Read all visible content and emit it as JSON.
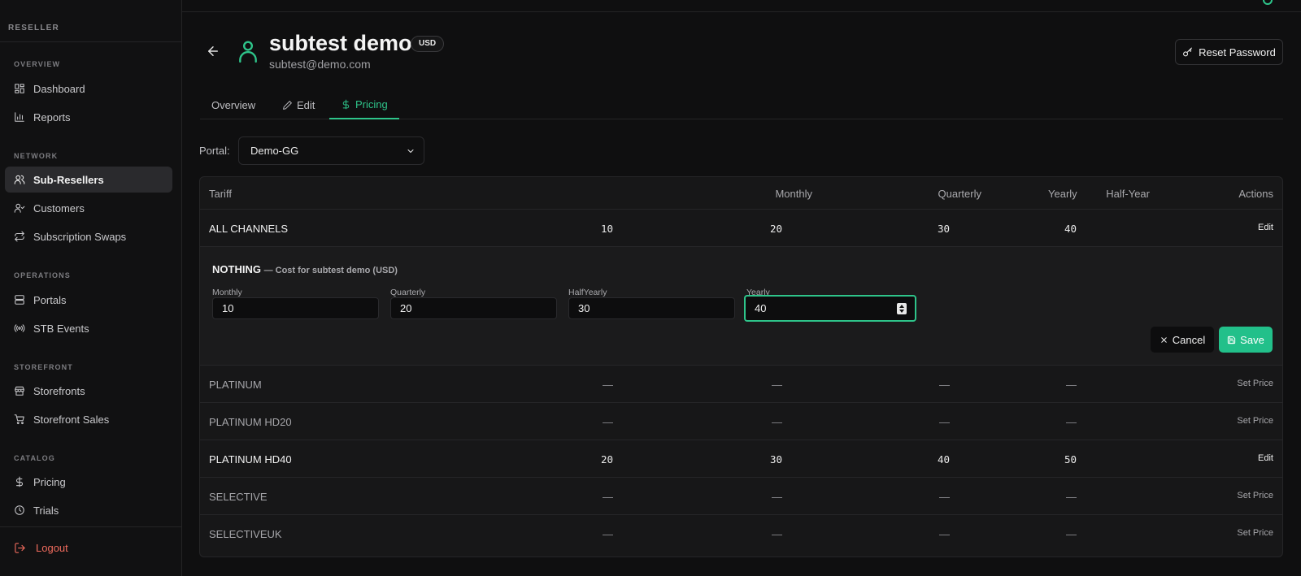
{
  "sidebar": {
    "brand": "RESELLER",
    "sections": {
      "overview": "OVERVIEW",
      "network": "NETWORK",
      "operations": "OPERATIONS",
      "storefront": "STOREFRONT",
      "catalog": "CATALOG"
    },
    "items": {
      "dashboard": "Dashboard",
      "reports": "Reports",
      "sub_resellers": "Sub-Resellers",
      "customers": "Customers",
      "subscription_swaps": "Subscription Swaps",
      "portals": "Portals",
      "stb_events": "STB Events",
      "storefronts": "Storefronts",
      "storefront_sales": "Storefront Sales",
      "pricing": "Pricing",
      "trials": "Trials"
    },
    "logout": "Logout"
  },
  "header": {
    "name": "subtest demo",
    "currency_badge": "USD",
    "email": "subtest@demo.com",
    "reset_password": "Reset Password"
  },
  "tabs": {
    "overview": "Overview",
    "edit": "Edit",
    "pricing": "Pricing"
  },
  "portal": {
    "label": "Portal:",
    "selected": "Demo-GG"
  },
  "table": {
    "headers": {
      "tariff": "Tariff",
      "monthly": "Monthly",
      "quarterly": "Quarterly",
      "half_year": "Half-Year",
      "yearly": "Yearly",
      "actions": "Actions"
    },
    "rows": [
      {
        "tariff": "ALL CHANNELS",
        "monthly": "10",
        "quarterly": "20",
        "half_year": "30",
        "yearly": "40",
        "action": "Edit"
      },
      {
        "tariff": "PLATINUM",
        "monthly": "—",
        "quarterly": "—",
        "half_year": "—",
        "yearly": "—",
        "action": "Set Price"
      },
      {
        "tariff": "PLATINUM HD20",
        "monthly": "—",
        "quarterly": "—",
        "half_year": "—",
        "yearly": "—",
        "action": "Set Price"
      },
      {
        "tariff": "PLATINUM HD40",
        "monthly": "20",
        "quarterly": "30",
        "half_year": "40",
        "yearly": "50",
        "action": "Edit"
      },
      {
        "tariff": "SELECTIVE",
        "monthly": "—",
        "quarterly": "—",
        "half_year": "—",
        "yearly": "—",
        "action": "Set Price"
      },
      {
        "tariff": "SELECTIVEUK",
        "monthly": "—",
        "quarterly": "—",
        "half_year": "—",
        "yearly": "—",
        "action": "Set Price"
      }
    ]
  },
  "editor": {
    "title": "NOTHING",
    "subtitle": "— Cost for subtest demo (USD)",
    "fields": {
      "monthly_label": "Monthly",
      "monthly_value": "10",
      "quarterly_label": "Quarterly",
      "quarterly_value": "20",
      "halfyearly_label": "HalfYearly",
      "halfyearly_value": "30",
      "yearly_label": "Yearly",
      "yearly_value": "40"
    },
    "cancel": "Cancel",
    "save": "Save"
  },
  "colors": {
    "accent": "#22c08a",
    "danger": "#f06b5d",
    "background": "#0f0f10"
  }
}
